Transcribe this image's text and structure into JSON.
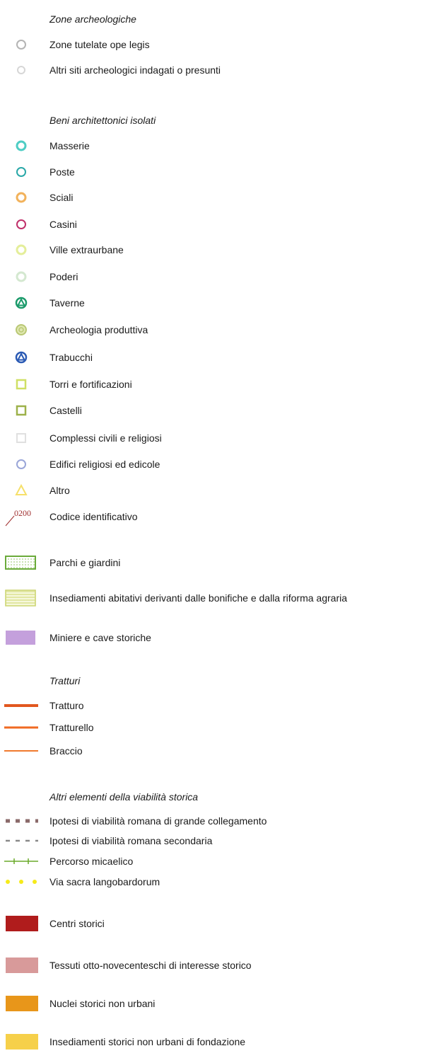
{
  "sections": {
    "zone_archeologiche": {
      "title": "Zone archeologiche",
      "items": [
        {
          "label": "Zone tutelate ope legis",
          "icon": "circle-outline-icon",
          "color": "#b4b4b4"
        },
        {
          "label": "Altri siti archeologici indagati o presunti",
          "icon": "circle-outline-icon",
          "color": "#d6d6d6"
        }
      ]
    },
    "beni_architettonici": {
      "title": "Beni architettonici isolati",
      "items": [
        {
          "label": "Masserie",
          "icon": "circle-outline-icon",
          "color": "#4ecdc4"
        },
        {
          "label": "Poste",
          "icon": "circle-outline-icon",
          "color": "#2aa8a8"
        },
        {
          "label": "Sciali",
          "icon": "circle-outline-icon",
          "color": "#f2b25b"
        },
        {
          "label": "Casini",
          "icon": "circle-outline-icon",
          "color": "#c0306a"
        },
        {
          "label": "Ville extraurbane",
          "icon": "circle-outline-icon",
          "color": "#e4ee9a"
        },
        {
          "label": "Poderi",
          "icon": "circle-outline-icon",
          "color": "#d4e8d0"
        },
        {
          "label": "Taverne",
          "icon": "triangle-in-circle-icon",
          "color": "#1a9a6a"
        },
        {
          "label": "Archeologia produttiva",
          "icon": "gear-circle-icon",
          "color": "#b9c774"
        },
        {
          "label": "Trabucchi",
          "icon": "triangle-in-circle-icon",
          "color": "#2a5ab4"
        },
        {
          "label": "Torri e fortificazioni",
          "icon": "square-outline-icon",
          "color": "#cfe065"
        },
        {
          "label": "Castelli",
          "icon": "square-outline-icon",
          "color": "#9db14a"
        },
        {
          "label": "Complessi civili e religiosi",
          "icon": "square-outline-icon",
          "color": "#e0e0e0"
        },
        {
          "label": "Edifici religiosi ed edicole",
          "icon": "circle-outline-icon",
          "color": "#9aa6d8"
        },
        {
          "label": "Altro",
          "icon": "triangle-outline-icon",
          "color": "#f6e06a"
        }
      ],
      "code": {
        "sample": "0200",
        "label": "Codice identificativo",
        "color": "#a03030"
      }
    },
    "areas": [
      {
        "label": "Parchi e giardini",
        "icon": "dotted-box-icon",
        "color": "#6aaa3a"
      },
      {
        "label": "Insediamenti abitativi derivanti dalle bonifiche e dalla riforma agraria",
        "icon": "striped-box-icon",
        "color": "#c8d26a"
      },
      {
        "label": "Miniere e cave storiche",
        "icon": "filled-box-icon",
        "color": "#c4a0dc"
      }
    ],
    "tratturi": {
      "title": "Tratturi",
      "items": [
        {
          "label": "Tratturo",
          "icon": "thick-line-icon",
          "color": "#e2571f"
        },
        {
          "label": "Tratturello",
          "icon": "medium-line-icon",
          "color": "#f06a22"
        },
        {
          "label": "Braccio",
          "icon": "thin-line-icon",
          "color": "#f07a2e"
        }
      ]
    },
    "viabilita": {
      "title": "Altri elementi della viabilità storica",
      "items": [
        {
          "label": "Ipotesi di viabilità romana di grande collegamento",
          "icon": "square-dash-line-icon",
          "color": "#8a6a6a"
        },
        {
          "label": "Ipotesi di viabilità romana secondaria",
          "icon": "dash-line-icon",
          "color": "#8a8a8a"
        },
        {
          "label": "Percorso micaelico",
          "icon": "tick-line-icon",
          "color": "#6aaa2a"
        },
        {
          "label": "Via sacra langobardorum",
          "icon": "dot-line-icon",
          "color": "#f6ea1a"
        }
      ]
    },
    "centri": [
      {
        "label": "Centri storici",
        "icon": "filled-box-icon",
        "color": "#b01c1c"
      },
      {
        "label": "Tessuti otto-novecenteschi di interesse storico",
        "icon": "filled-box-icon",
        "color": "#d89a9a"
      },
      {
        "label": "Nuclei storici non urbani",
        "icon": "filled-box-icon",
        "color": "#e8961a"
      },
      {
        "label": "Insediamenti storici non urbani di fondazione",
        "icon": "filled-box-icon",
        "color": "#f6d04a"
      }
    ]
  }
}
